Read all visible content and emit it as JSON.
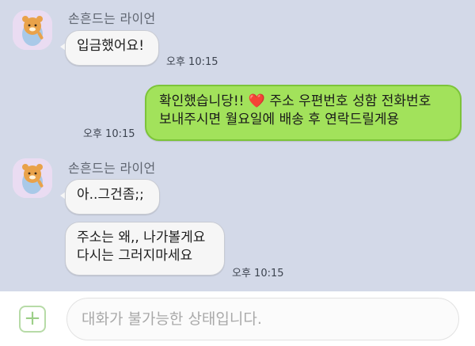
{
  "colors": {
    "chat_background": "#d3d9e8",
    "incoming_bubble": "#f6f6f6",
    "outgoing_bubble": "#a2e25b",
    "input_bar": "#ffffff"
  },
  "messages": [
    {
      "sender": "손흔드는 라이언",
      "text": "입금했어요!",
      "time": "오후 10:15",
      "direction": "in"
    },
    {
      "text_line1": "확인했습니당!! ",
      "heart": "❤️",
      "text_line1b": " 주소 우편번호 성함 전화번호",
      "text_line2": "보내주시면 월요일에 배송 후 연락드릴게용",
      "time": "오후 10:15",
      "direction": "out"
    },
    {
      "sender": "손흔드는 라이언",
      "text": "아..그건좀;;",
      "direction": "in"
    },
    {
      "text_line1": "주소는 왜,, 나가볼게요",
      "text_line2": "다시는 그러지마세요",
      "time": "오후 10:15",
      "direction": "in"
    }
  ],
  "input": {
    "placeholder": "대화가 불가능한 상태입니다.",
    "plus_icon": "plus-icon"
  }
}
